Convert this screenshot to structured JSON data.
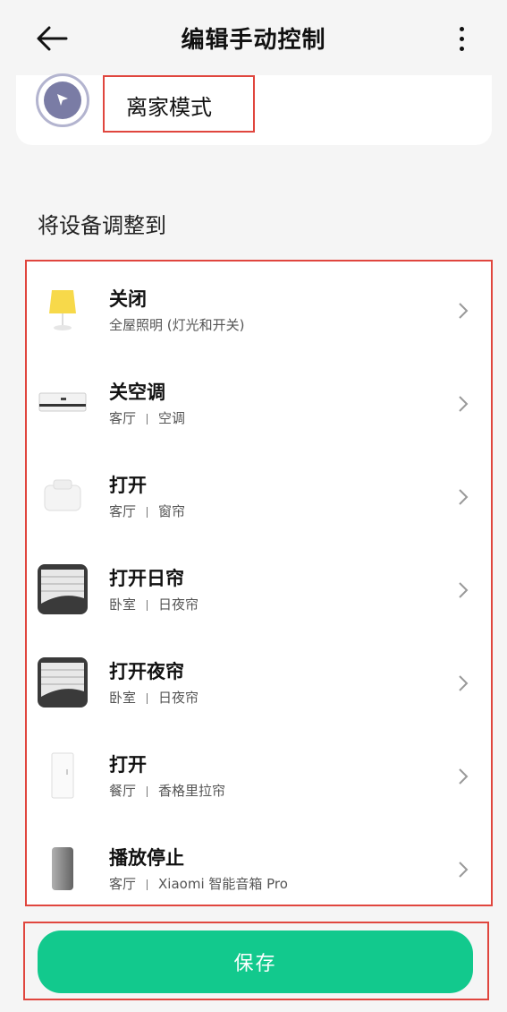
{
  "header": {
    "title": "编辑手动控制",
    "back_icon": "back-arrow-icon",
    "more_icon": "more-vertical-icon"
  },
  "scene": {
    "name": "离家模式",
    "icon": "cursor-arrow-icon",
    "icon_color": "#7a7ca5"
  },
  "section": {
    "title": "将设备调整到"
  },
  "devices": [
    {
      "title": "关闭",
      "room": "",
      "location": "全屋照明 (灯光和开关)",
      "icon": "lamp-icon"
    },
    {
      "title": "关空调",
      "room": "客厅",
      "location": "空调",
      "icon": "air-conditioner-icon"
    },
    {
      "title": "打开",
      "room": "客厅",
      "location": "窗帘",
      "icon": "curtain-motor-icon"
    },
    {
      "title": "打开日帘",
      "room": "卧室",
      "location": "日夜帘",
      "icon": "honeycomb-blind-icon"
    },
    {
      "title": "打开夜帘",
      "room": "卧室",
      "location": "日夜帘",
      "icon": "honeycomb-blind-icon"
    },
    {
      "title": "打开",
      "room": "餐厅",
      "location": "香格里拉帘",
      "icon": "blind-controller-icon"
    },
    {
      "title": "播放停止",
      "room": "客厅",
      "location": "Xiaomi 智能音箱 Pro",
      "icon": "smart-speaker-icon"
    }
  ],
  "footer": {
    "save_label": "保存",
    "accent_color": "#12c98d"
  },
  "highlight_color": "#e0463e"
}
